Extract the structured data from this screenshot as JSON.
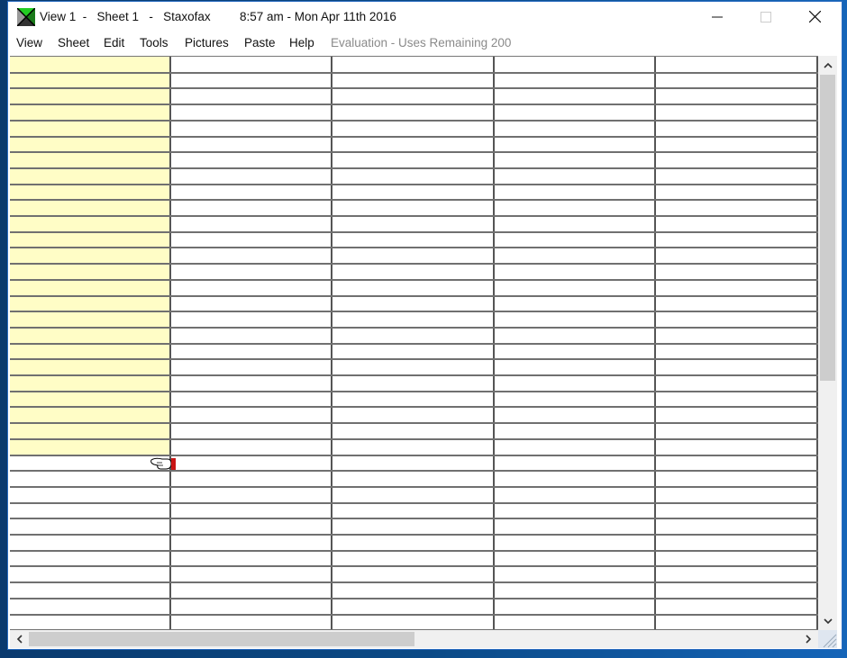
{
  "window": {
    "title": "View 1  -   Sheet 1   -   Staxofax",
    "clock": "8:57 am - Mon Apr 11th  2016",
    "controls": {
      "minimize_icon": "minimize-icon",
      "maximize_icon": "maximize-icon",
      "close_icon": "close-icon"
    },
    "app_icon": "staxofax-app-icon"
  },
  "menubar": {
    "items": [
      {
        "label": "View"
      },
      {
        "label": "Sheet"
      },
      {
        "label": "Edit"
      },
      {
        "label": "Tools"
      },
      {
        "label": "Pictures"
      },
      {
        "label": "Paste"
      },
      {
        "label": "Help"
      }
    ],
    "evaluation_notice": "Evaluation - Uses Remaining 200"
  },
  "sheet": {
    "columns": 5,
    "visible_rows": 36,
    "highlighted_column": 1,
    "highlighted_rows": 25,
    "highlight_color": "#fffdc6",
    "grid_line_color": "#707070",
    "cursor": "pointing-hand-cursor"
  },
  "scrollbars": {
    "vertical": {
      "up_icon": "chevron-up-icon",
      "down_icon": "chevron-down-icon",
      "position_fraction": 0.0
    },
    "horizontal": {
      "left_icon": "chevron-left-icon",
      "right_icon": "chevron-right-icon",
      "position_fraction": 0.0
    }
  }
}
